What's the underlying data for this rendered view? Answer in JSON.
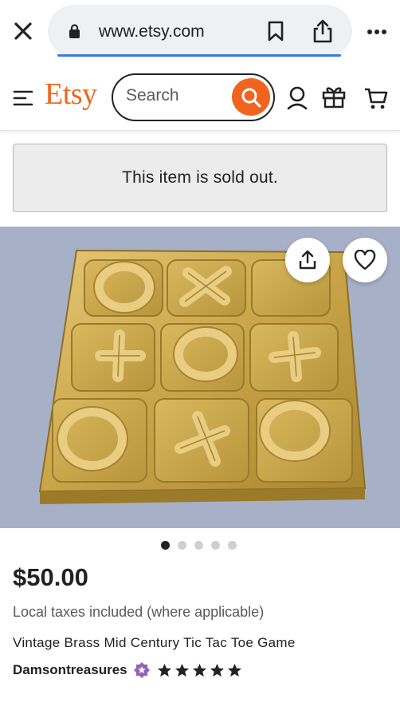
{
  "browser": {
    "url": "www.etsy.com"
  },
  "header": {
    "logo": "Etsy",
    "search_placeholder": "Search"
  },
  "notice": {
    "sold_out": "This item is sold out."
  },
  "gallery": {
    "total_images": 5,
    "active_index": 0
  },
  "listing": {
    "price": "$50.00",
    "tax_note": "Local taxes included (where applicable)",
    "title": "Vintage Brass Mid Century Tic Tac Toe Game",
    "shop_name": "Damsontreasures",
    "rating_stars": 5
  },
  "colors": {
    "brand": "#f1641e",
    "star_seller": "#9560b8",
    "url_progress": "#3a7be0"
  },
  "icons": [
    "close-icon",
    "lock-icon",
    "bookmark-icon",
    "share-icon",
    "more-icon",
    "hamburger-icon",
    "search-icon",
    "user-icon",
    "gift-icon",
    "cart-icon",
    "share-icon",
    "heart-icon",
    "star-seller-icon",
    "star-icon"
  ]
}
